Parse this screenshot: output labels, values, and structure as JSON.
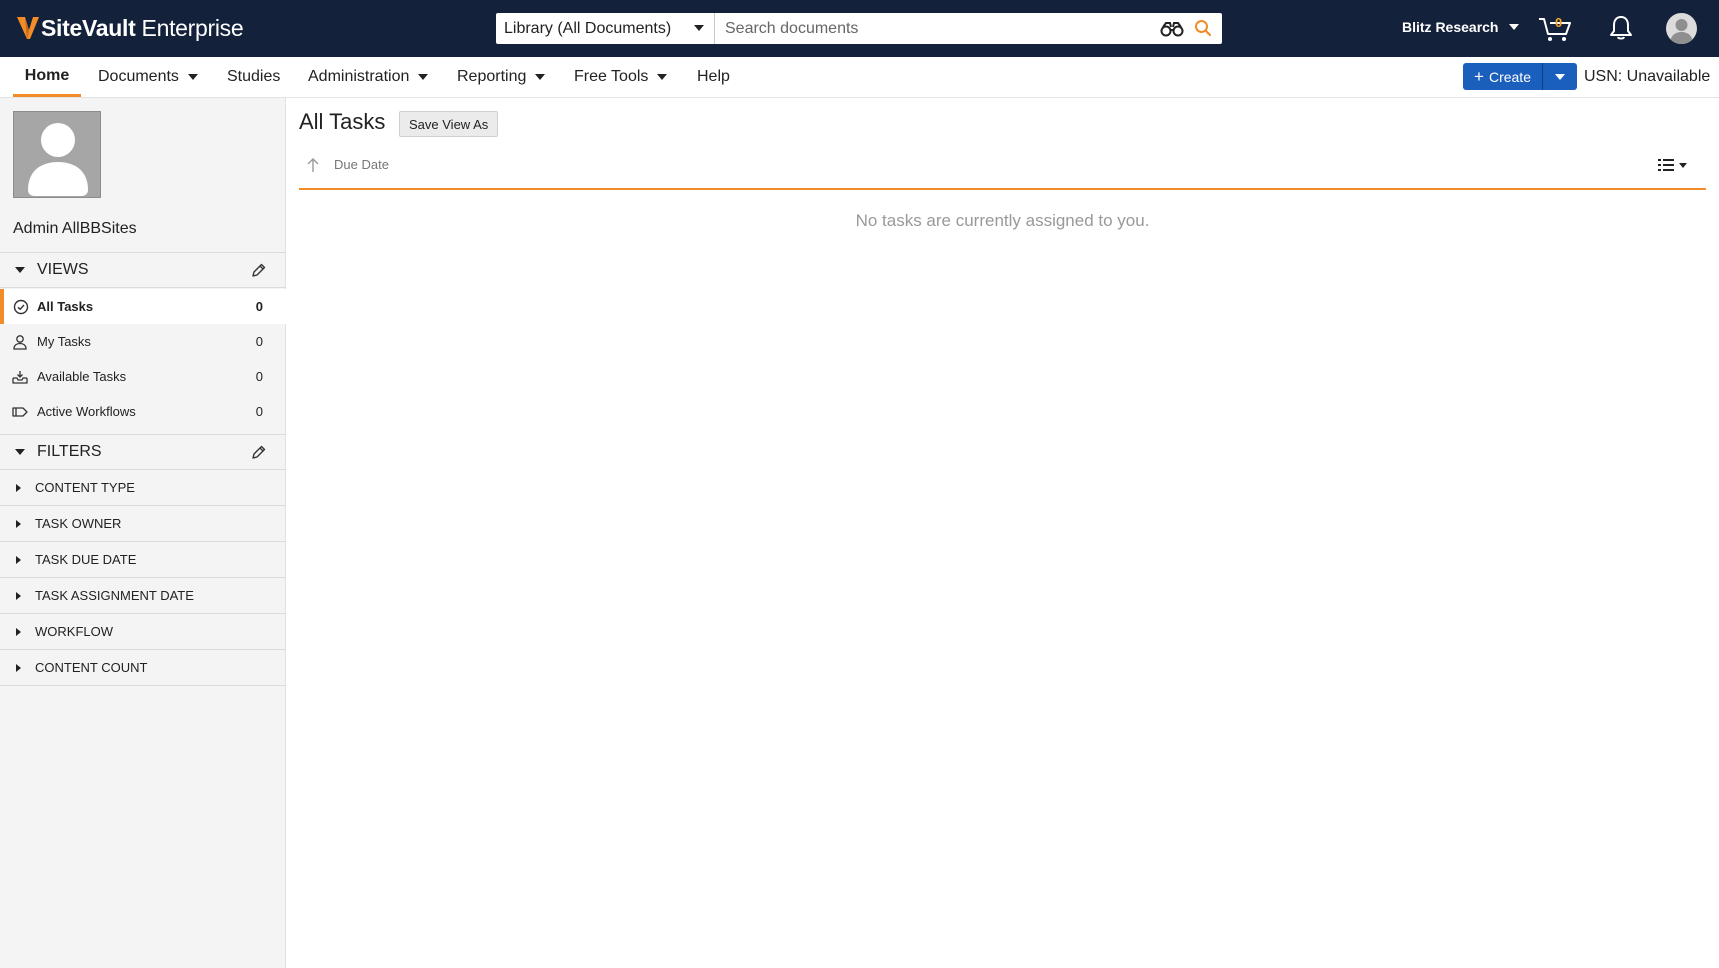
{
  "header": {
    "logo_bold": "SiteVault",
    "logo_light": "Enterprise",
    "search_scope": "Library (All Documents)",
    "search_placeholder": "Search documents",
    "vault_name": "Blitz Research",
    "cart_count": "0"
  },
  "nav": {
    "home": "Home",
    "documents": "Documents",
    "studies": "Studies",
    "administration": "Administration",
    "reporting": "Reporting",
    "free_tools": "Free Tools",
    "help": "Help",
    "create": "Create",
    "usn": "USN: Unavailable"
  },
  "sidebar": {
    "user_name": "Admin AllBBSites",
    "views_title": "VIEWS",
    "views": [
      {
        "label": "All Tasks",
        "count": "0",
        "icon": "check-circle-icon"
      },
      {
        "label": "My Tasks",
        "count": "0",
        "icon": "person-icon"
      },
      {
        "label": "Available Tasks",
        "count": "0",
        "icon": "inbox-icon"
      },
      {
        "label": "Active Workflows",
        "count": "0",
        "icon": "workflow-icon"
      }
    ],
    "filters_title": "FILTERS",
    "filters": [
      "CONTENT TYPE",
      "TASK OWNER",
      "TASK DUE DATE",
      "TASK ASSIGNMENT DATE",
      "WORKFLOW",
      "CONTENT COUNT"
    ]
  },
  "main": {
    "title": "All Tasks",
    "save_view_label": "Save View As",
    "sort_label": "Due Date",
    "empty_message": "No tasks are currently assigned to you."
  },
  "colors": {
    "header_bg": "#14213a",
    "accent_orange": "#f28c28",
    "create_blue": "#1b5fbd"
  }
}
